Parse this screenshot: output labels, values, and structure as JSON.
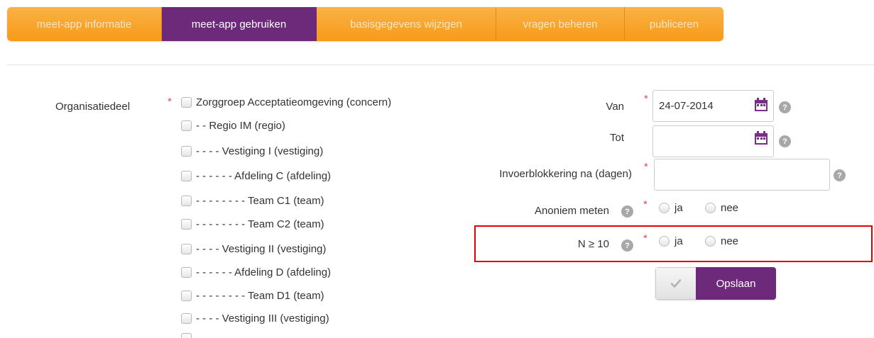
{
  "tabs": [
    {
      "label": "meet-app informatie"
    },
    {
      "label": "meet-app gebruiken"
    },
    {
      "label": "basisgegevens wijzigen"
    },
    {
      "label": "vragen beheren"
    },
    {
      "label": "publiceren"
    }
  ],
  "active_tab": "meet-app gebruiken",
  "form": {
    "org_label": "Organisatiedeel",
    "required_marker": "*",
    "org_items": [
      {
        "label": "Zorggroep Acceptatieomgeving (concern)"
      },
      {
        "label": "- - Regio IM (regio)"
      },
      {
        "label": "- - - - Vestiging I (vestiging)"
      },
      {
        "label": "- - - - - - Afdeling C (afdeling)"
      },
      {
        "label": "- - - - - - - - Team C1 (team)"
      },
      {
        "label": "- - - - - - - - Team C2 (team)"
      },
      {
        "label": "- - - - Vestiging II (vestiging)"
      },
      {
        "label": "- - - - - - Afdeling D (afdeling)"
      },
      {
        "label": "- - - - - - - - Team D1 (team)"
      },
      {
        "label": "- - - - Vestiging III (vestiging)"
      }
    ],
    "van_label": "Van",
    "van_value": "24-07-2014",
    "tot_label": "Tot",
    "tot_value": "",
    "invoer_label": "Invoerblokkering na (dagen)",
    "invoer_value": "",
    "anoniem_label": "Anoniem meten",
    "n10_label": "N ≥ 10",
    "radio_ja": "ja",
    "radio_nee": "nee",
    "help_glyph": "?",
    "save_label": "Opslaan"
  },
  "colors": {
    "tab_orange": "#f79a18",
    "tab_active": "#6d2a7a",
    "required": "#e0457b",
    "highlight": "#e00000",
    "calendar_icon": "#7a2f87"
  }
}
